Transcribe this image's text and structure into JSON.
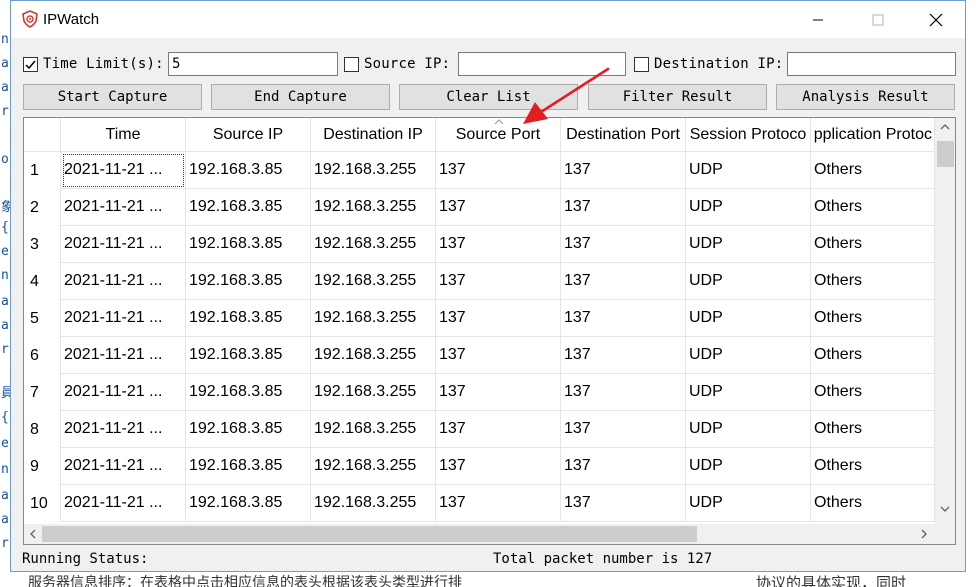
{
  "window": {
    "title": "IPWatch"
  },
  "toolbar": {
    "time_limit_label": "Time Limit(s):",
    "time_limit_checked": true,
    "time_limit_value": "5",
    "source_ip_label": "Source IP:",
    "source_ip_checked": false,
    "source_ip_value": "",
    "dest_ip_label": "Destination IP:",
    "dest_ip_checked": false,
    "dest_ip_value": "",
    "buttons": [
      "Start Capture",
      "End Capture",
      "Clear List",
      "Filter Result",
      "Analysis Result"
    ]
  },
  "table": {
    "columns": [
      "Time",
      "Source IP",
      "Destination IP",
      "Source Port",
      "Destination Port",
      "Session Protoco",
      "pplication Protoc"
    ],
    "sorted_column": "Source Port",
    "rows": [
      {
        "n": "1",
        "time": "2021-11-21 ...",
        "src": "192.168.3.85",
        "dst": "192.168.3.255",
        "sport": "137",
        "dport": "137",
        "session": "UDP",
        "app": "Others"
      },
      {
        "n": "2",
        "time": "2021-11-21 ...",
        "src": "192.168.3.85",
        "dst": "192.168.3.255",
        "sport": "137",
        "dport": "137",
        "session": "UDP",
        "app": "Others"
      },
      {
        "n": "3",
        "time": "2021-11-21 ...",
        "src": "192.168.3.85",
        "dst": "192.168.3.255",
        "sport": "137",
        "dport": "137",
        "session": "UDP",
        "app": "Others"
      },
      {
        "n": "4",
        "time": "2021-11-21 ...",
        "src": "192.168.3.85",
        "dst": "192.168.3.255",
        "sport": "137",
        "dport": "137",
        "session": "UDP",
        "app": "Others"
      },
      {
        "n": "5",
        "time": "2021-11-21 ...",
        "src": "192.168.3.85",
        "dst": "192.168.3.255",
        "sport": "137",
        "dport": "137",
        "session": "UDP",
        "app": "Others"
      },
      {
        "n": "6",
        "time": "2021-11-21 ...",
        "src": "192.168.3.85",
        "dst": "192.168.3.255",
        "sport": "137",
        "dport": "137",
        "session": "UDP",
        "app": "Others"
      },
      {
        "n": "7",
        "time": "2021-11-21 ...",
        "src": "192.168.3.85",
        "dst": "192.168.3.255",
        "sport": "137",
        "dport": "137",
        "session": "UDP",
        "app": "Others"
      },
      {
        "n": "8",
        "time": "2021-11-21 ...",
        "src": "192.168.3.85",
        "dst": "192.168.3.255",
        "sport": "137",
        "dport": "137",
        "session": "UDP",
        "app": "Others"
      },
      {
        "n": "9",
        "time": "2021-11-21 ...",
        "src": "192.168.3.85",
        "dst": "192.168.3.255",
        "sport": "137",
        "dport": "137",
        "session": "UDP",
        "app": "Others"
      },
      {
        "n": "10",
        "time": "2021-11-21 ...",
        "src": "192.168.3.85",
        "dst": "192.168.3.255",
        "sport": "137",
        "dport": "137",
        "session": "UDP",
        "app": "Others"
      }
    ]
  },
  "status": {
    "running_label": "Running Status:",
    "total": "Total packet number is 127"
  },
  "background": {
    "left_glyphs": [
      "n",
      "a",
      "a",
      "r",
      "o",
      "象",
      "{",
      "e",
      "n",
      "a",
      "a",
      "r",
      "員",
      "{",
      "e",
      "n",
      "a",
      "a",
      "r"
    ],
    "bottom_left_text": "服务器信息排序：在表格中点击相应信息的表头根据该表头类型进行排",
    "bottom_right_text": "协议的具体实现，同时"
  },
  "colors": {
    "accent": "#0078d7",
    "annotation_arrow": "#e02020",
    "icon_red": "#d9342b"
  }
}
